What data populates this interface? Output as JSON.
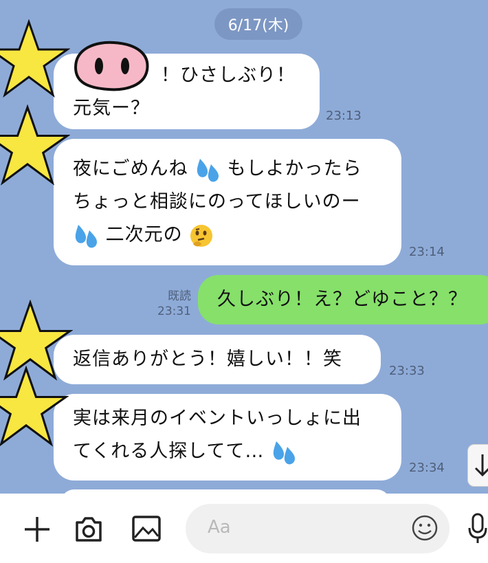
{
  "chat": {
    "date": "6/17(木)",
    "messages": [
      {
        "line1": "！ひさしぶり！",
        "line2": "元気ー？",
        "time": "23:13"
      },
      {
        "line1a": "夜にごめんね",
        "line1b": "もしよかったら",
        "line2": "ちょっと相談にのってほしいのー",
        "line3": "二次元の",
        "time": "23:14"
      },
      {
        "text": "久しぶり！え？どゆこと？？",
        "read": "既読",
        "time": "23:31"
      },
      {
        "text": "返信ありがとう！嬉しい！！笑",
        "time": "23:33"
      },
      {
        "line1": "実は来月のイベントいっしょに出",
        "line2": "てくれる人探してて…",
        "time": "23:34"
      }
    ]
  },
  "input": {
    "placeholder": "Aa"
  },
  "icons": {
    "plus": "plus-icon",
    "camera": "camera-icon",
    "image": "image-icon",
    "emoji": "emoji-icon",
    "mic": "microphone-icon",
    "scroll": "scroll-down-icon"
  },
  "colors": {
    "background": "#8eabd8",
    "incoming": "#ffffff",
    "outgoing": "#86e06a"
  }
}
